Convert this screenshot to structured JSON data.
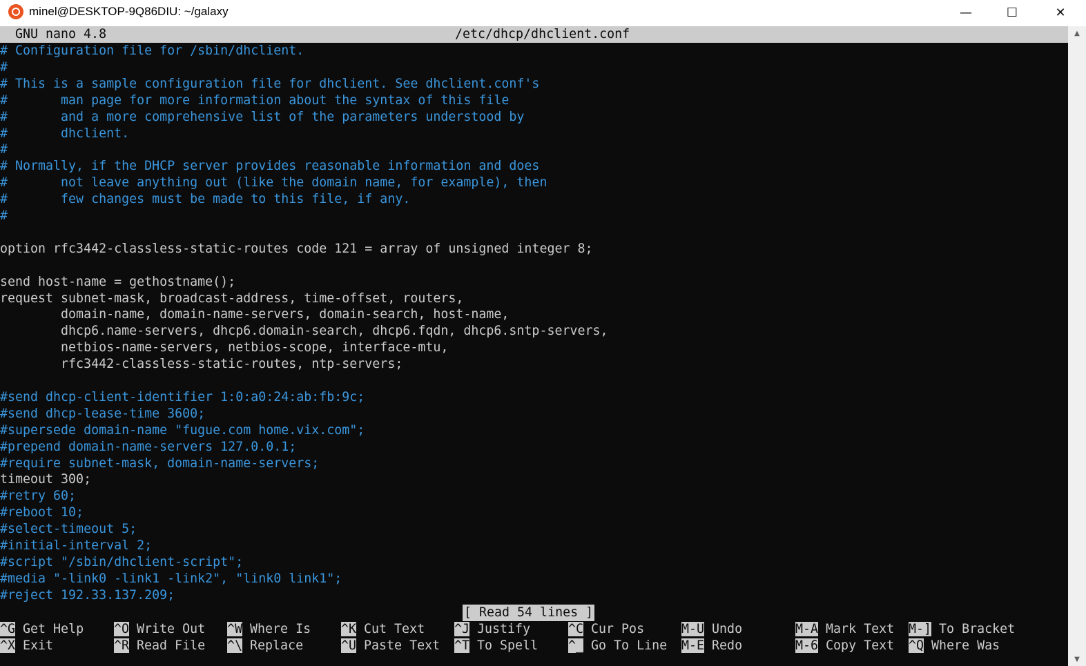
{
  "window": {
    "title": "minel@DESKTOP-9Q86DIU: ~/galaxy",
    "minimize_glyph": "—",
    "maximize_glyph": "☐",
    "close_glyph": "✕",
    "app_icon": "ubuntu-icon"
  },
  "nano": {
    "version": "GNU nano 4.8",
    "filename": "/etc/dhcp/dhclient.conf",
    "status": "[ Read 54 lines ]"
  },
  "colors": {
    "terminal_bg": "#0c0c0c",
    "text": "#cccccc",
    "comment": "#3a96dd",
    "inverse_bg": "#cccccc"
  },
  "lines": [
    {
      "text": "# Configuration file for /sbin/dhclient.",
      "kind": "comment"
    },
    {
      "text": "#",
      "kind": "comment"
    },
    {
      "text": "# This is a sample configuration file for dhclient. See dhclient.conf's",
      "kind": "comment"
    },
    {
      "text": "#       man page for more information about the syntax of this file",
      "kind": "comment"
    },
    {
      "text": "#       and a more comprehensive list of the parameters understood by",
      "kind": "comment"
    },
    {
      "text": "#       dhclient.",
      "kind": "comment"
    },
    {
      "text": "#",
      "kind": "comment"
    },
    {
      "text": "# Normally, if the DHCP server provides reasonable information and does",
      "kind": "comment"
    },
    {
      "text": "#       not leave anything out (like the domain name, for example), then",
      "kind": "comment"
    },
    {
      "text": "#       few changes must be made to this file, if any.",
      "kind": "comment"
    },
    {
      "text": "#",
      "kind": "comment"
    },
    {
      "text": "",
      "kind": "code"
    },
    {
      "text": "option rfc3442-classless-static-routes code 121 = array of unsigned integer 8;",
      "kind": "code"
    },
    {
      "text": "",
      "kind": "code"
    },
    {
      "text": "send host-name = gethostname();",
      "kind": "code"
    },
    {
      "text": "request subnet-mask, broadcast-address, time-offset, routers,",
      "kind": "code"
    },
    {
      "text": "        domain-name, domain-name-servers, domain-search, host-name,",
      "kind": "code"
    },
    {
      "text": "        dhcp6.name-servers, dhcp6.domain-search, dhcp6.fqdn, dhcp6.sntp-servers,",
      "kind": "code"
    },
    {
      "text": "        netbios-name-servers, netbios-scope, interface-mtu,",
      "kind": "code"
    },
    {
      "text": "        rfc3442-classless-static-routes, ntp-servers;",
      "kind": "code"
    },
    {
      "text": "",
      "kind": "code"
    },
    {
      "text": "#send dhcp-client-identifier 1:0:a0:24:ab:fb:9c;",
      "kind": "comment"
    },
    {
      "text": "#send dhcp-lease-time 3600;",
      "kind": "comment"
    },
    {
      "text": "#supersede domain-name \"fugue.com home.vix.com\";",
      "kind": "comment"
    },
    {
      "text": "#prepend domain-name-servers 127.0.0.1;",
      "kind": "comment"
    },
    {
      "text": "#require subnet-mask, domain-name-servers;",
      "kind": "comment"
    },
    {
      "text": "timeout 300;",
      "kind": "code"
    },
    {
      "text": "#retry 60;",
      "kind": "comment"
    },
    {
      "text": "#reboot 10;",
      "kind": "comment"
    },
    {
      "text": "#select-timeout 5;",
      "kind": "comment"
    },
    {
      "text": "#initial-interval 2;",
      "kind": "comment"
    },
    {
      "text": "#script \"/sbin/dhclient-script\";",
      "kind": "comment"
    },
    {
      "text": "#media \"-link0 -link1 -link2\", \"link0 link1\";",
      "kind": "comment"
    },
    {
      "text": "#reject 192.33.137.209;",
      "kind": "comment"
    }
  ],
  "shortcuts": [
    [
      {
        "key": "^G",
        "label": "Get Help"
      },
      {
        "key": "^O",
        "label": "Write Out"
      },
      {
        "key": "^W",
        "label": "Where Is"
      },
      {
        "key": "^K",
        "label": "Cut Text"
      },
      {
        "key": "^J",
        "label": "Justify"
      },
      {
        "key": "^C",
        "label": "Cur Pos"
      },
      {
        "key": "M-U",
        "label": "Undo"
      },
      {
        "key": "M-A",
        "label": "Mark Text"
      },
      {
        "key": "M-]",
        "label": "To Bracket"
      }
    ],
    [
      {
        "key": "^X",
        "label": "Exit"
      },
      {
        "key": "^R",
        "label": "Read File"
      },
      {
        "key": "^\\",
        "label": "Replace"
      },
      {
        "key": "^U",
        "label": "Paste Text"
      },
      {
        "key": "^T",
        "label": "To Spell"
      },
      {
        "key": "^_",
        "label": "Go To Line"
      },
      {
        "key": "M-E",
        "label": "Redo"
      },
      {
        "key": "M-6",
        "label": "Copy Text"
      },
      {
        "key": "^Q",
        "label": "Where Was"
      }
    ]
  ]
}
